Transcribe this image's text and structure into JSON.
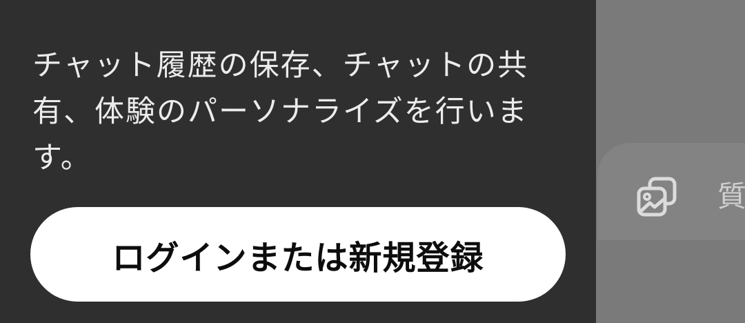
{
  "drawer": {
    "description": "チャット履歴の保存、チャットの共有、体験のパーソナライズを行います。",
    "login_button_label": "ログインまたは新規登録"
  },
  "main": {
    "composer": {
      "attach_icon": "image-icon",
      "placeholder": "質"
    }
  },
  "colors": {
    "drawer_bg": "#2f2f2f",
    "drawer_text": "#ececec",
    "button_bg": "#ffffff",
    "button_text": "#0d0d0d",
    "overlay_bg": "#7a7a7a",
    "composer_bg": "#838383",
    "placeholder_text": "#cfcfcf",
    "icon_stroke": "#dcdcdc"
  }
}
